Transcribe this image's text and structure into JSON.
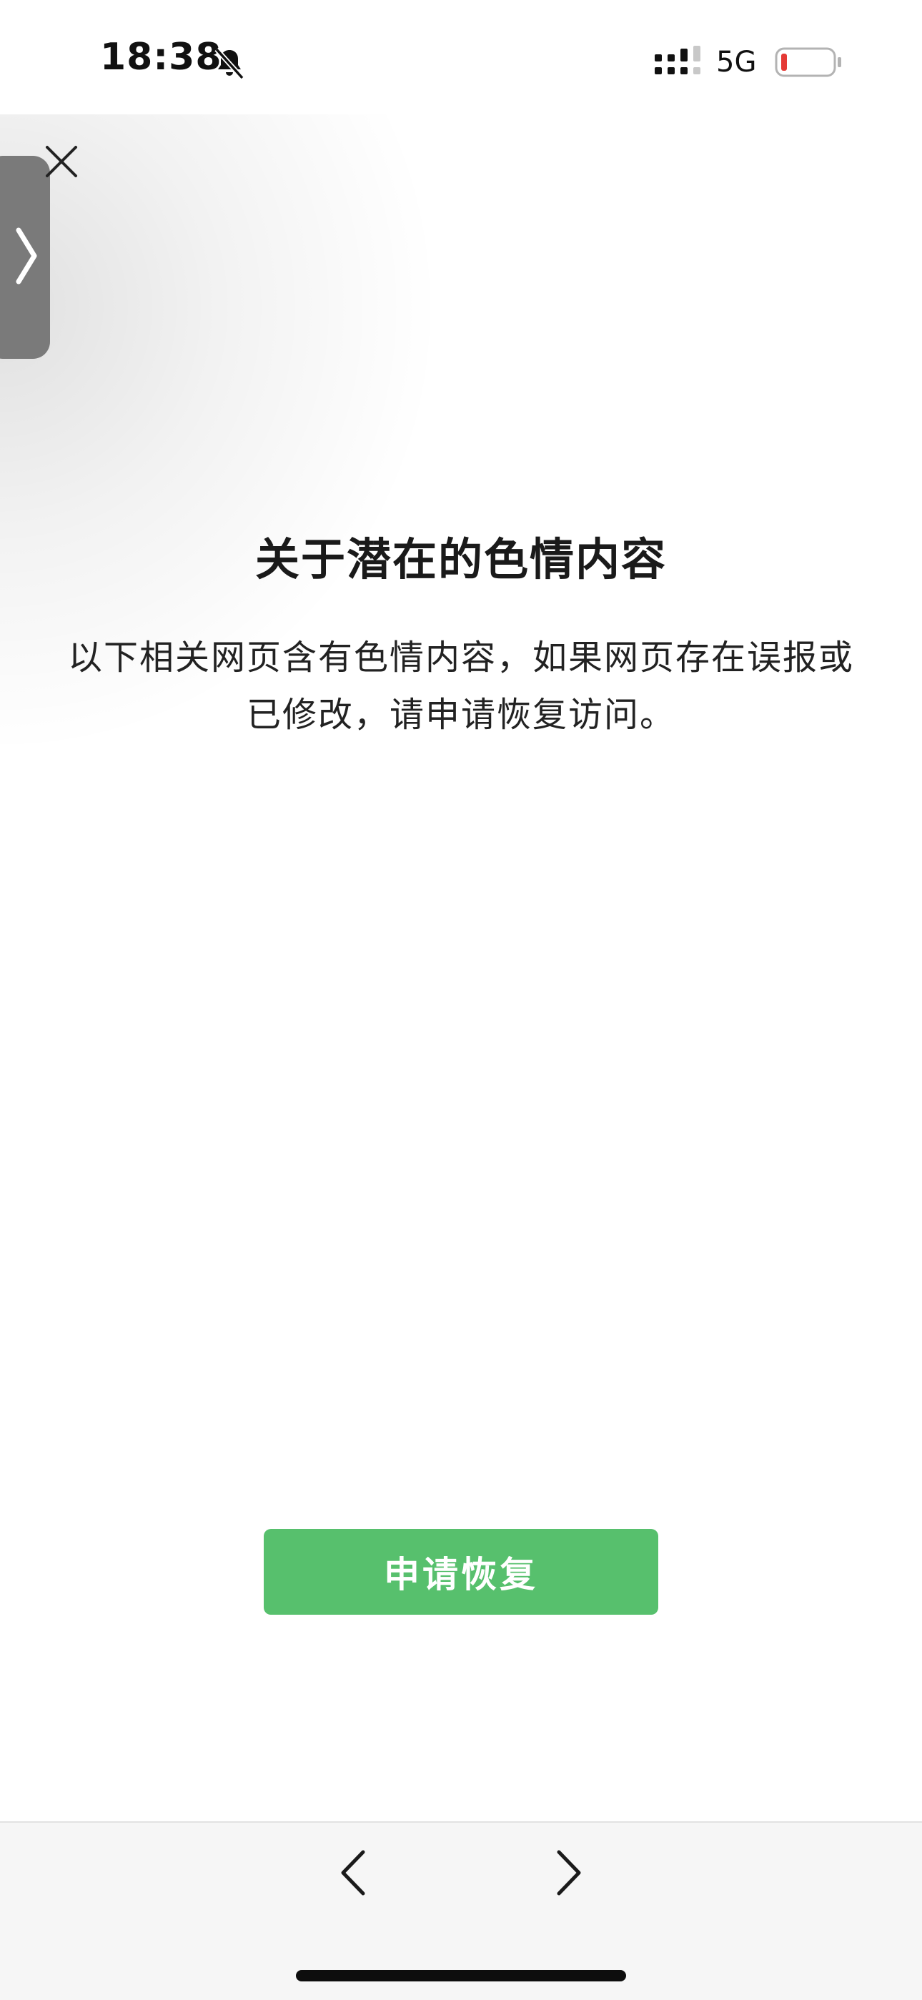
{
  "status_bar": {
    "time": "18:38",
    "network": "5G",
    "icons": [
      "bell-slash-icon",
      "signal-icon",
      "battery-low-icon"
    ],
    "battery_color": "#e53935"
  },
  "content": {
    "title": "关于潜在的色情内容",
    "description": "以下相关网页含有色情内容，如果网页存在误报或已修改，请申请恢复访问。"
  },
  "actions": {
    "restore_label": "申请恢复",
    "restore_color": "#57c06d"
  },
  "toolbar": {
    "icons": [
      "close-icon",
      "side-tab-chevron-icon",
      "chevron-left-icon",
      "chevron-right-icon"
    ]
  }
}
